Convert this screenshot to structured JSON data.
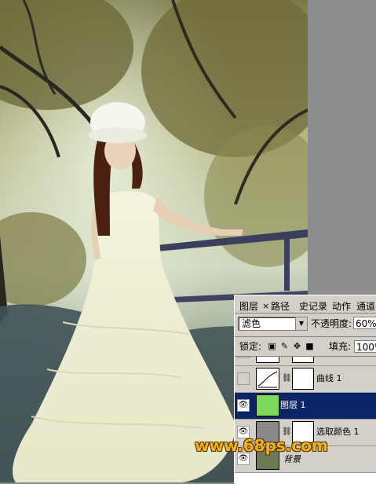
{
  "panel": {
    "tabs": [
      "图层",
      "路径",
      "史记录",
      "动作",
      "通道"
    ],
    "tab_close": "×",
    "blend_mode": "滤色",
    "opacity_label": "不透明度:",
    "opacity_value": "60%",
    "lock_label": "锁定:",
    "fill_label": "填充:",
    "fill_value": "100%",
    "layers": [
      {
        "name": "",
        "visible": false
      },
      {
        "name": "曲线 1",
        "visible": false
      },
      {
        "name": "图层 1",
        "visible": true,
        "selected": true
      },
      {
        "name": "选取颜色 1",
        "visible": true
      },
      {
        "name": "背景",
        "visible": true
      }
    ]
  },
  "watermark": "www.68ps.com",
  "colors": {
    "selected": "#0a246a",
    "panel_bg": "#d4d0c8",
    "watermark": "#f0b020"
  }
}
